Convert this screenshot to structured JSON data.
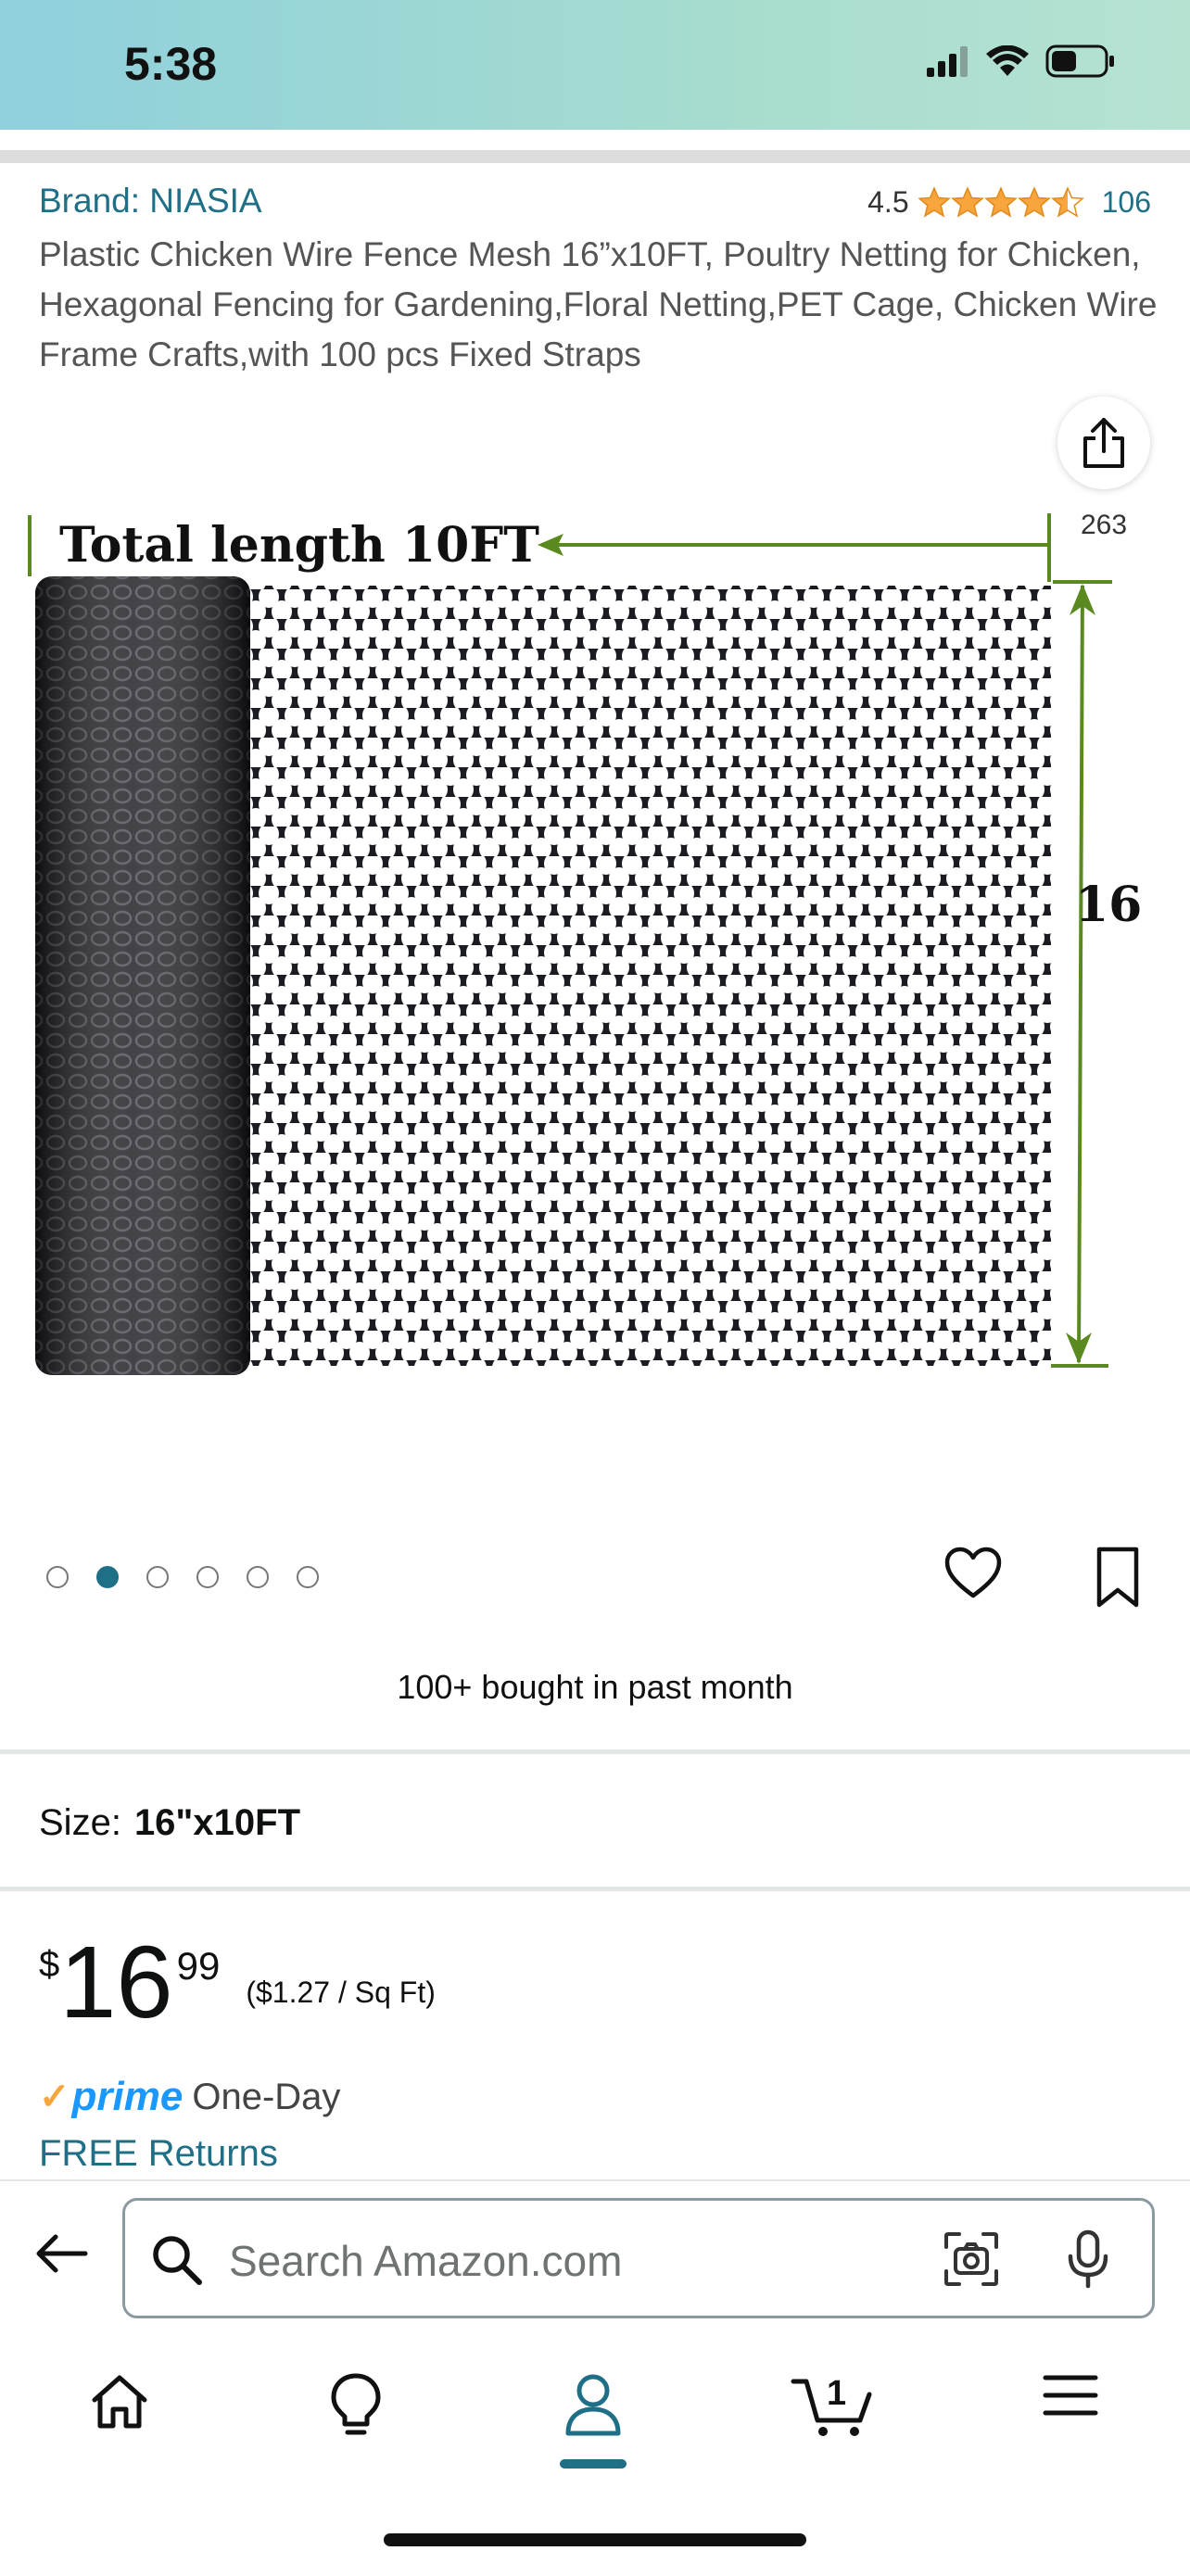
{
  "status_bar": {
    "time": "5:38"
  },
  "product": {
    "brand": "Brand: NIASIA",
    "rating": "4.5",
    "rating_stars": 4.5,
    "review_count": "106",
    "title": "Plastic Chicken Wire Fence Mesh 16”x10FT, Poultry Netting for Chicken, Hexagonal Fencing for Gardening,Floral Netting,PET Cage, Chicken Wire Frame Crafts,with 100 pcs Fixed Straps",
    "share_count": "263",
    "image_labels": {
      "length": "Total length 10FT",
      "height": "16\""
    },
    "carousel": {
      "total": 6,
      "active_index": 1
    },
    "bought": "100+ bought in past month",
    "size_label": "Size:",
    "size_value": "16\"x10FT",
    "price": {
      "symbol": "$",
      "whole": "16",
      "cents": "99",
      "unit_price": "($1.27 / Sq Ft)"
    },
    "prime_word": "prime",
    "delivery": "One-Day",
    "returns": "FREE Returns"
  },
  "search": {
    "placeholder": "Search Amazon.com"
  },
  "nav": {
    "cart_count": "1",
    "active": "account"
  },
  "colors": {
    "link": "#1f6f86",
    "star": "#f7a53c",
    "prime": "#1a98ff",
    "status_bg": "#8fd0dc"
  }
}
